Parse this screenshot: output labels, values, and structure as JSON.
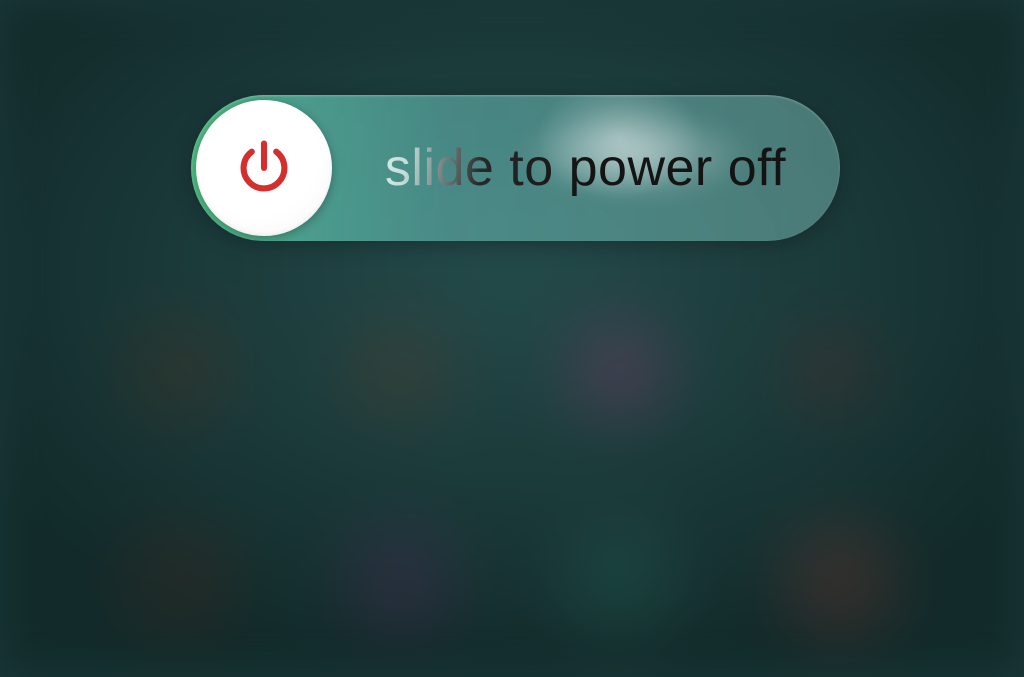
{
  "power_off": {
    "slider_label": "slide to power off",
    "icon_name": "power-icon",
    "icon_color": "#d32f2f",
    "track_color_start": "#5ad791",
    "track_color_end": "#6eaaa5"
  }
}
